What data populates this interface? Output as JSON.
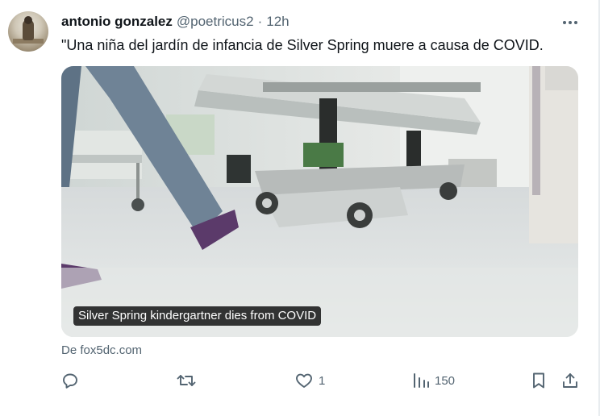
{
  "tweet": {
    "display_name": "antonio gonzalez",
    "handle": "@poetricus2",
    "separator": "·",
    "time": "12h",
    "text": "\"Una niña del jardín de infancia de Silver Spring muere a causa de COVID.",
    "card": {
      "caption": "Silver Spring kindergartner dies from COVID",
      "source": "De fox5dc.com"
    },
    "actions": {
      "reply_count": "",
      "retweet_count": "",
      "like_count": "1",
      "views_count": "150"
    }
  },
  "icons": {
    "more": "more-icon",
    "reply": "reply-icon",
    "retweet": "retweet-icon",
    "like": "heart-icon",
    "views": "views-icon",
    "bookmark": "bookmark-icon",
    "share": "share-icon"
  },
  "colors": {
    "text": "#0f1419",
    "secondary": "#536471",
    "caption_bg": "#000000",
    "background": "#ffffff"
  }
}
